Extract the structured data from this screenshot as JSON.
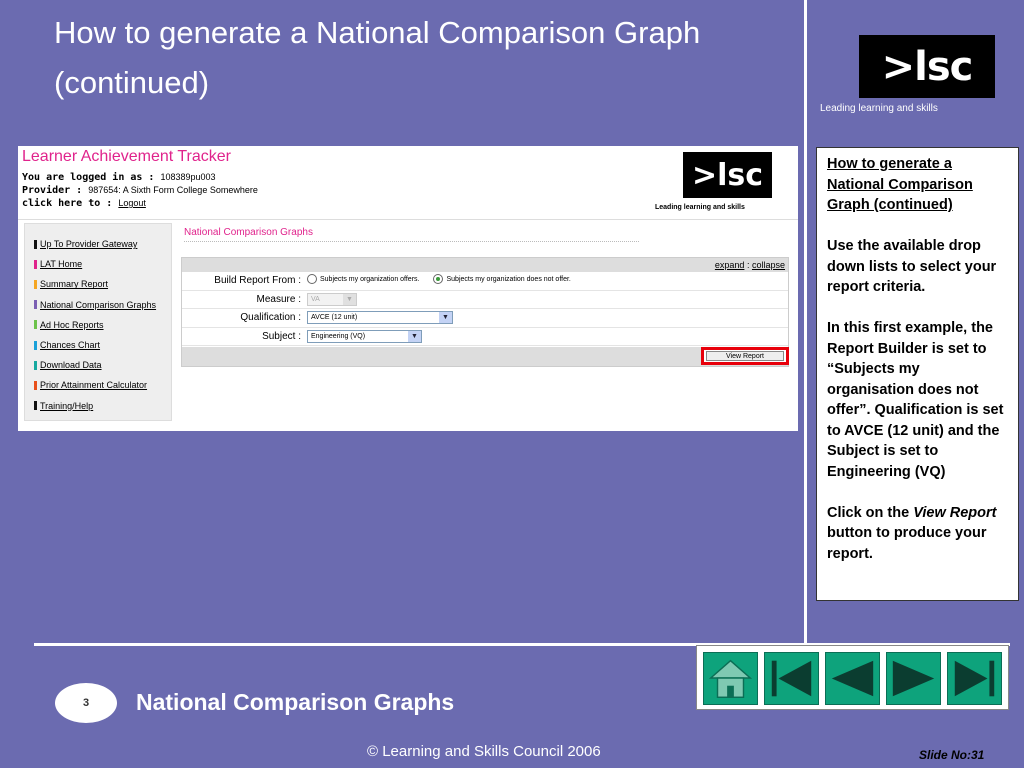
{
  "slide": {
    "title": "How to generate a National Comparison Graph (continued)",
    "logo_text": ">lsc",
    "logo_tagline": "Leading learning and skills",
    "footer_title": "National Comparison Graphs",
    "slide_badge": "3",
    "copyright": "© Learning and Skills Council 2006",
    "slide_number": "Slide No:31"
  },
  "app": {
    "title": "Learner Achievement Tracker",
    "logged_in_label": "You are logged in as :",
    "logged_in_value": "108389pu003",
    "provider_label": "Provider :",
    "provider_value": "987654: A Sixth Form College Somewhere",
    "click_label": "click here to :",
    "logout_link": "Logout",
    "logo_text": ">lsc",
    "logo_tagline": "Leading learning and skills",
    "nav": [
      {
        "label": "Up To Provider Gateway",
        "color": "#111111"
      },
      {
        "label": "LAT Home",
        "color": "#e0238c"
      },
      {
        "label": "Summary Report",
        "color": "#f5a623"
      },
      {
        "label": "National Comparison Graphs",
        "color": "#7b5fb3"
      },
      {
        "label": "Ad Hoc Reports",
        "color": "#6cc24a"
      },
      {
        "label": "Chances Chart",
        "color": "#1ba1d9"
      },
      {
        "label": "Download Data",
        "color": "#17a9a0"
      },
      {
        "label": "Prior Attainment Calculator",
        "color": "#e8501b"
      },
      {
        "label": "Training/Help",
        "color": "#111111"
      }
    ],
    "section_title": "National Comparison Graphs",
    "expand_link": "expand",
    "separator": ":",
    "collapse_link": "collapse",
    "form": {
      "build_label": "Build Report From :",
      "option1": "Subjects my organization offers.",
      "option2": "Subjects my organization does not offer.",
      "measure_label": "Measure :",
      "measure_value": "VA",
      "qualification_label": "Qualification :",
      "qualification_value": "AVCE (12 unit)",
      "subject_label": "Subject :",
      "subject_value": "Engineering (VQ)",
      "view_report_button": "View Report"
    }
  },
  "notes": {
    "title": "How to generate a National Comparison Graph (continued)",
    "para1": "Use the available drop down lists to select your report criteria.",
    "para2": "In this first example, the Report Builder is set to “Subjects my organisation does not offer”. Qualification is set to AVCE (12 unit) and the Subject is set to Engineering (VQ)",
    "para3_prefix": "Click on the ",
    "para3_em": "View Report",
    "para3_suffix": "  button to produce your report."
  },
  "navigation": [
    {
      "name": "home-icon"
    },
    {
      "name": "first-slide-icon"
    },
    {
      "name": "previous-slide-icon"
    },
    {
      "name": "next-slide-icon"
    },
    {
      "name": "last-slide-icon"
    }
  ]
}
